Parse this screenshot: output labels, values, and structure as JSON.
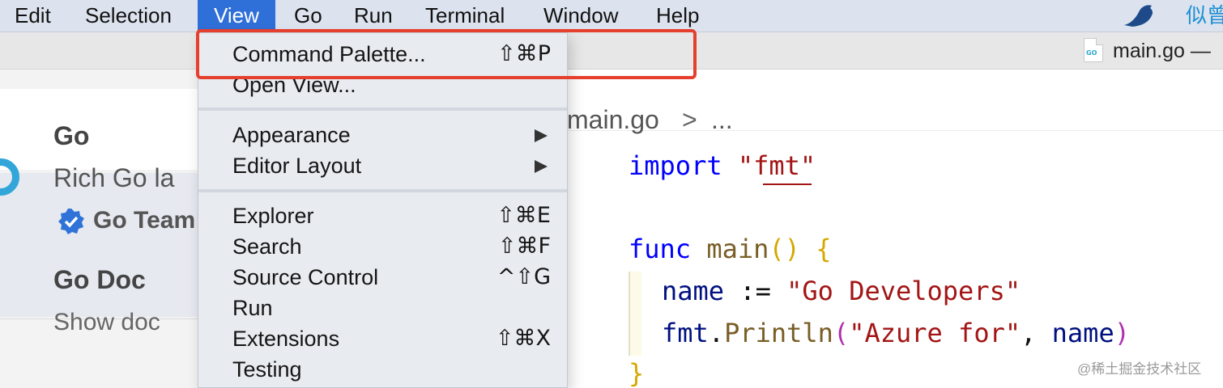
{
  "menubar": {
    "items": [
      "Edit",
      "Selection",
      "View",
      "Go",
      "Run",
      "Terminal",
      "Window",
      "Help"
    ],
    "active": "View",
    "right_text": "似曾"
  },
  "window": {
    "title_file": "main.go —"
  },
  "view_menu": {
    "items": [
      {
        "label": "Command Palette...",
        "shortcut": "⇧⌘P"
      },
      {
        "label": "Open View...",
        "shortcut": ""
      },
      {
        "label": "Appearance",
        "submenu": true
      },
      {
        "label": "Editor Layout",
        "submenu": true
      },
      {
        "label": "Explorer",
        "shortcut": "⇧⌘E"
      },
      {
        "label": "Search",
        "shortcut": "⇧⌘F"
      },
      {
        "label": "Source Control",
        "shortcut": "^⇧G"
      },
      {
        "label": "Run",
        "shortcut": ""
      },
      {
        "label": "Extensions",
        "shortcut": "⇧⌘X"
      },
      {
        "label": "Testing",
        "shortcut": ""
      }
    ]
  },
  "extensions": [
    {
      "title": "Go",
      "description": "Rich Go la",
      "publisher": "Go Team"
    },
    {
      "title": "Go Doc",
      "description": "Show doc"
    }
  ],
  "breadcrumb": {
    "file": "main.go",
    "separator": ">",
    "more": "..."
  },
  "code": {
    "import_kw": "import",
    "import_path": "\"fmt\"",
    "func_kw": "func",
    "func_name": "main",
    "open_paren": "(",
    "close_paren": ")",
    "open_brace": "{",
    "close_brace": "}",
    "var_name": "name",
    "assign_op": ":=",
    "var_value": "\"Go Developers\"",
    "call_pkg": "fmt",
    "call_dot": ".",
    "call_fn": "Println",
    "call_open": "(",
    "call_arg1": "\"Azure for\"",
    "call_comma": ", ",
    "call_arg2": "name",
    "call_close": ")"
  },
  "watermark": "@稀土掘金技术社区",
  "colors": {
    "highlight": "#e53f2e",
    "menu_active": "#2f6fd8",
    "keyword": "#0000ff",
    "string": "#a31515"
  }
}
